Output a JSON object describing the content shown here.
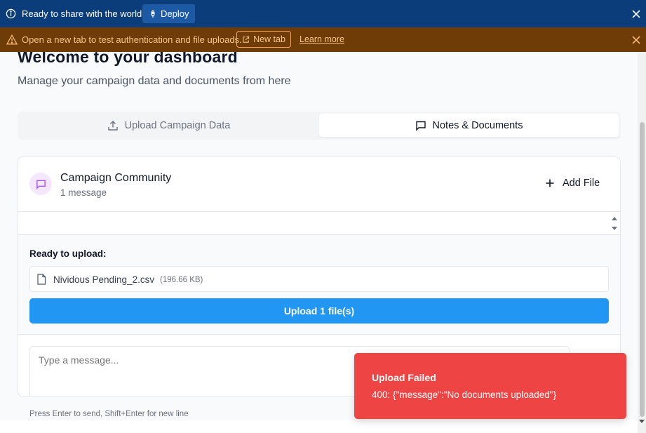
{
  "banner_top": {
    "message": "Ready to share with the world?",
    "deploy_label": "Deploy",
    "colors": {
      "background": "#0b3d7a",
      "button": "#1c5aa6"
    }
  },
  "banner_warning": {
    "message": "Open a new tab to test authentication and file uploads.",
    "new_tab_label": "New tab",
    "learn_more_label": "Learn more",
    "colors": {
      "background": "#6f3b06",
      "text": "#f9c58a"
    }
  },
  "page": {
    "title": "Welcome to your dashboard",
    "subtitle": "Manage your campaign data and documents from here"
  },
  "tabs": [
    {
      "label": "Upload Campaign Data",
      "icon": "upload-icon",
      "active": false
    },
    {
      "label": "Notes & Documents",
      "icon": "message-square-icon",
      "active": true
    }
  ],
  "community": {
    "title": "Campaign Community",
    "count_text": "1 message",
    "add_file_label": "Add File"
  },
  "upload": {
    "ready_label": "Ready to upload:",
    "file_name": "Nividous Pending_2.csv",
    "file_size": "(196.66 KB)",
    "upload_button_label": "Upload 1 file(s)",
    "button_color": "#2196f3"
  },
  "composer": {
    "placeholder": "Type a message...",
    "hint": "Press Enter to send, Shift+Enter for new line"
  },
  "toast": {
    "title": "Upload Failed",
    "description": "400: {\"message\":\"No documents uploaded\"}",
    "color": "#ef4444"
  }
}
